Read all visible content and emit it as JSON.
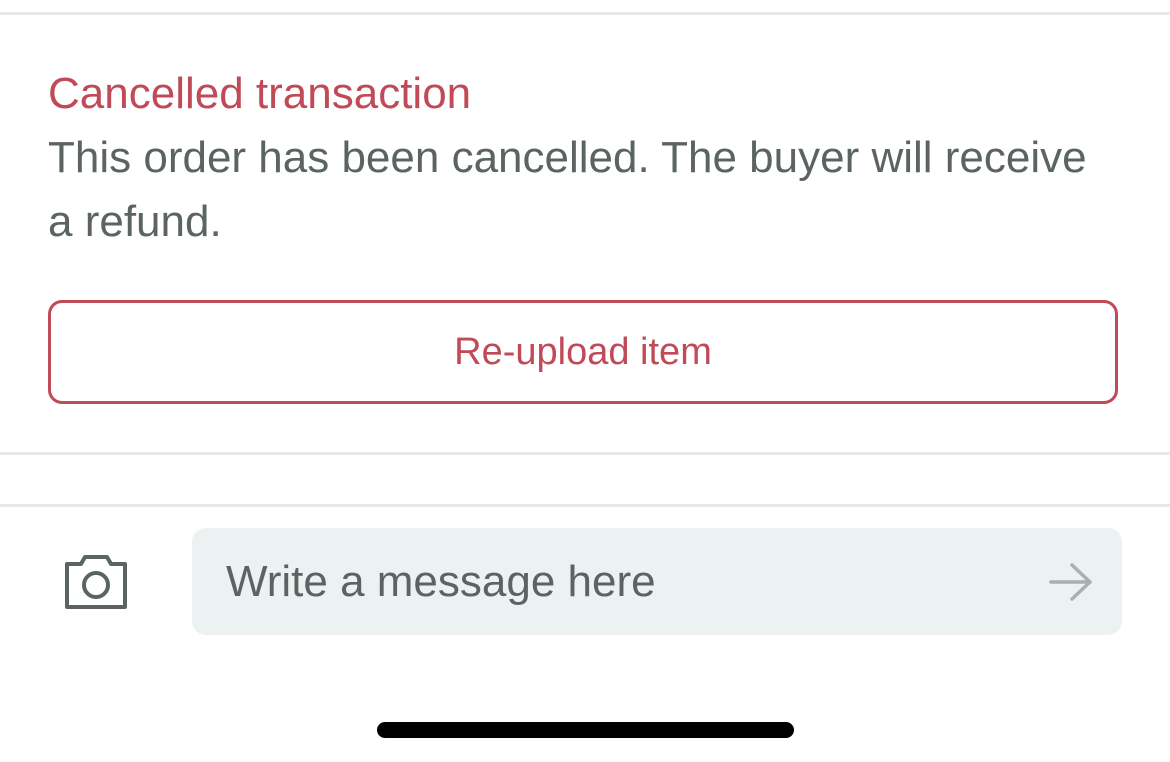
{
  "notice": {
    "title": "Cancelled transaction",
    "body": "This order has been cancelled. The buyer will receive a refund."
  },
  "actions": {
    "reupload_label": "Re-upload item"
  },
  "composer": {
    "placeholder": "Write a message here",
    "camera_icon": "camera-icon",
    "send_icon": "arrow-right-icon"
  },
  "colors": {
    "accent": "#c04a57",
    "text_secondary": "#5b6462",
    "composer_bg": "#ecf2f1",
    "divider": "#e6e8e8"
  }
}
